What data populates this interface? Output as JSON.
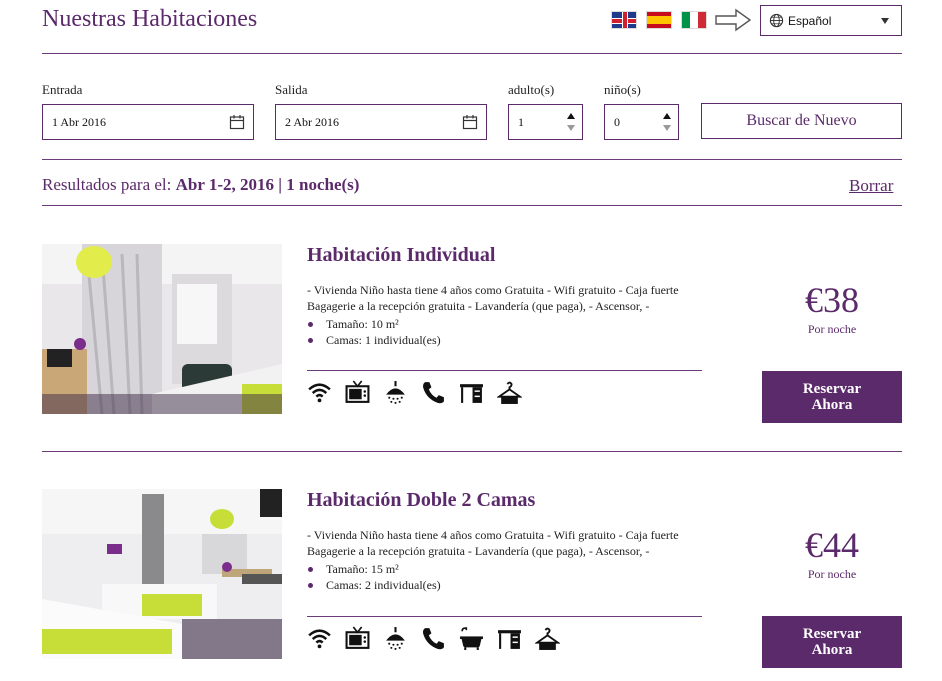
{
  "header": {
    "title": "Nuestras Habitaciones",
    "language": "Español",
    "flags": [
      "uk-flag-icon",
      "spain-flag-icon",
      "italy-flag-icon"
    ]
  },
  "search": {
    "checkin_label": "Entrada",
    "checkin_value": "1 Abr 2016",
    "checkout_label": "Salida",
    "checkout_value": "2 Abr 2016",
    "adults_label": "adulto(s)",
    "adults_value": "1",
    "children_label": "niño(s)",
    "children_value": "0",
    "search_button": "Buscar de Nuevo"
  },
  "results": {
    "prefix": "Resultados para el:",
    "dates": "Abr 1-2, 2016",
    "separator": "|",
    "nights": "1 noche(s)",
    "clear": "Borrar"
  },
  "rooms": [
    {
      "name": "Habitación Individual",
      "desc_line1": "- Vivienda Niño hasta tiene 4 años como Gratuita - Wifi gratuito - Caja fuerte",
      "desc_line2": "Bagagerie a la recepción gratuita - Lavandería (que paga), - Ascensor, -",
      "size": "Tamaño: 10 m²",
      "beds": "Camas: 1 individual(es)",
      "price": "€38",
      "per_night": "Por noche",
      "book_line1": "Reservar",
      "book_line2": "Ahora",
      "amenities": [
        "wifi-icon",
        "tv-icon",
        "shower-icon",
        "phone-icon",
        "desk-icon",
        "hanger-icon"
      ]
    },
    {
      "name": "Habitación Doble 2 Camas",
      "desc_line1": "- Vivienda Niño hasta tiene 4 años como Gratuita - Wifi gratuito - Caja fuerte",
      "desc_line2": "Bagagerie a la recepción gratuita - Lavandería (que paga), - Ascensor, -",
      "size": "Tamaño: 15 m²",
      "beds": "Camas: 2 individual(es)",
      "price": "€44",
      "per_night": "Por noche",
      "book_line1": "Reservar",
      "book_line2": "Ahora",
      "amenities": [
        "wifi-icon",
        "tv-icon",
        "shower-icon",
        "phone-icon",
        "bathtub-icon",
        "desk-icon",
        "hanger-icon"
      ]
    }
  ],
  "colors": {
    "accent": "#5b2a6b",
    "button_bg": "#5b2a6b",
    "button_text": "#ffffff"
  }
}
